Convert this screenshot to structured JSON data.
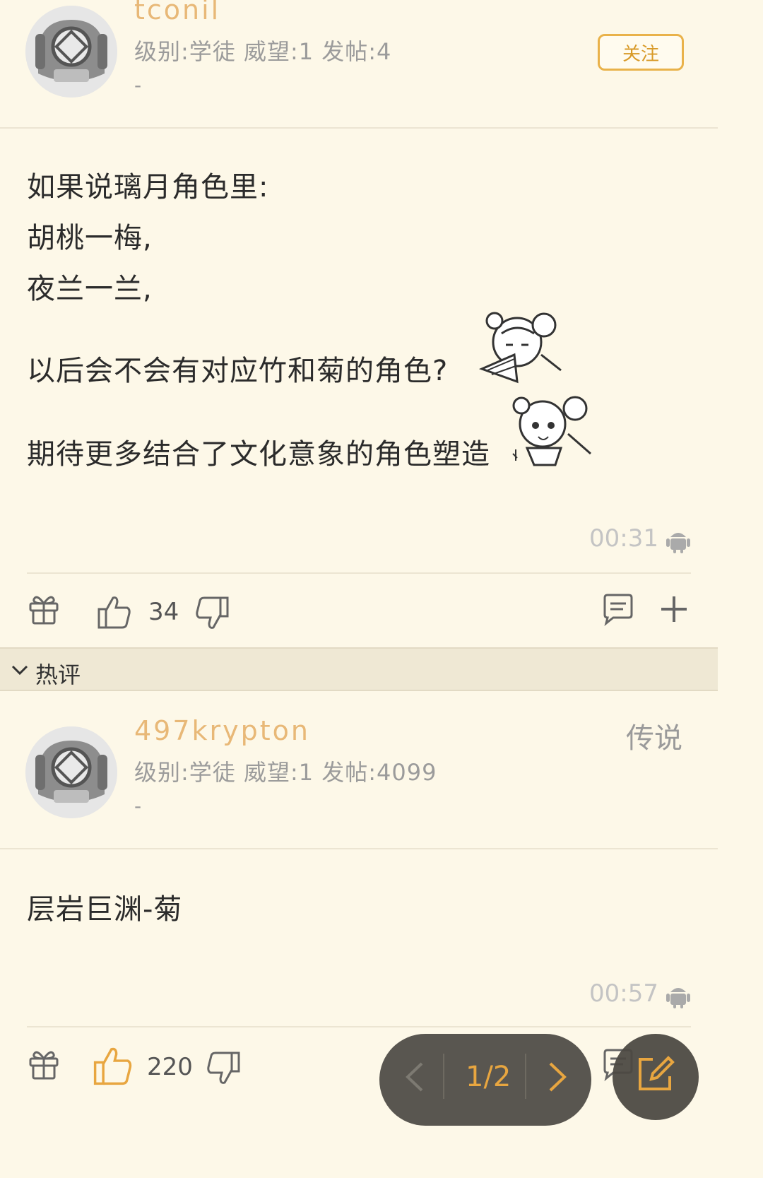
{
  "post": {
    "username": "tconil",
    "meta": "级别:学徒 威望:1 发帖:4",
    "signature": "-",
    "follow_label": "关注",
    "lines": [
      "如果说璃月角色里:",
      "胡桃一梅,",
      "夜兰一兰,",
      "以后会不会有对应竹和菊的角色?",
      "期待更多结合了文化意象的角色塑造"
    ],
    "time": "00:31",
    "like_count": "34"
  },
  "hot_section": {
    "label": "热评"
  },
  "reply": {
    "username": "497krypton",
    "rank": "传说",
    "meta": "级别:学徒 威望:1 发帖:4099",
    "signature": "-",
    "text": "层岩巨渊-菊",
    "time": "00:57",
    "like_count": "220"
  },
  "pager": {
    "label": "1/2"
  },
  "colors": {
    "background": "#fdf8e8",
    "accent": "#e9b24a",
    "username": "#e8b877"
  }
}
